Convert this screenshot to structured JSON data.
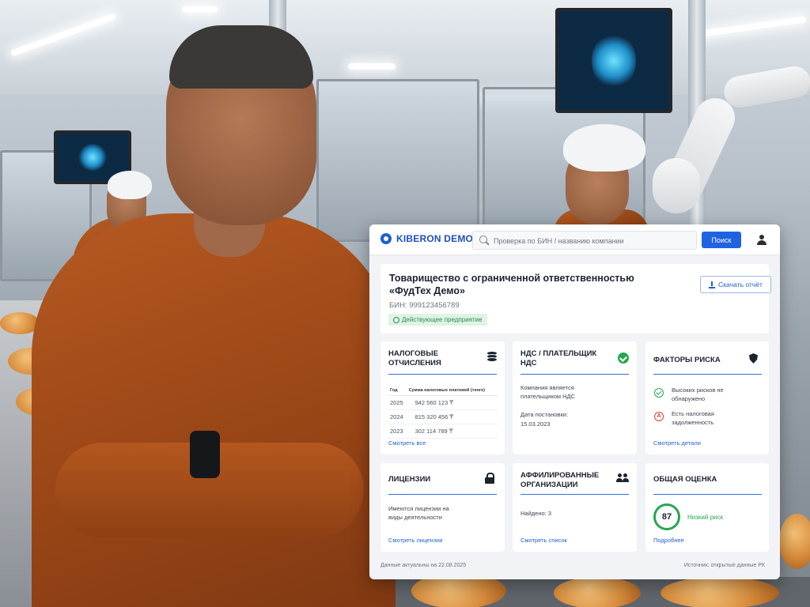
{
  "app": {
    "logo_text": "KIBERON DEMO"
  },
  "search": {
    "placeholder": "Проверка по БИН / названию компании",
    "button_label": "Поиск"
  },
  "company": {
    "title": "Товарищество с ограниченной ответственностью «ФудТех Демо»",
    "bin": "БИН: 999123456789",
    "status": "Действующее предприятие",
    "download_label": "Скачать отчёт"
  },
  "tax": {
    "title": "НАЛОГОВЫЕ ОТЧИСЛЕНИЯ",
    "col_year": "Год",
    "col_sum": "Сумма налоговых платежей (тенге)",
    "rows": [
      {
        "year": "2025",
        "sum": "942 560 123 ₸"
      },
      {
        "year": "2024",
        "sum": "815 320 456 ₸"
      },
      {
        "year": "2023",
        "sum": "302 114 789 ₸"
      }
    ],
    "link": "Смотреть все"
  },
  "vat": {
    "title": "НДС / ПЛАТЕЛЬЩИК НДС",
    "text": "Компания является плательщиком НДС",
    "date_label": "Дата постановки:",
    "date": "15.03.2023"
  },
  "risk": {
    "title": "ФАКТОРЫ РИСКА",
    "item1": "Высоких рисков не обнаружено",
    "item2": "Есть налоговая задолженность",
    "link": "Смотреть детали"
  },
  "licenses": {
    "title": "ЛИЦЕНЗИИ",
    "text": "Имеются лицензии на виды деятельности",
    "link": "Смотреть лицензии"
  },
  "affiliates": {
    "title": "АФФИЛИРОВАННЫЕ ОРГАНИЗАЦИИ",
    "found": "Найдено: 3",
    "link": "Смотреть список"
  },
  "score": {
    "title": "ОБЩАЯ ОЦЕНКА",
    "value": "87",
    "label": "Низкий риск",
    "link": "Подробнее"
  },
  "footer": {
    "updated": "Данные актуальны на 22.08.2025",
    "source": "Источник: открытые данные РК"
  },
  "colors": {
    "accent": "#1f63e0",
    "success": "#27a650",
    "danger": "#d83a3a"
  }
}
